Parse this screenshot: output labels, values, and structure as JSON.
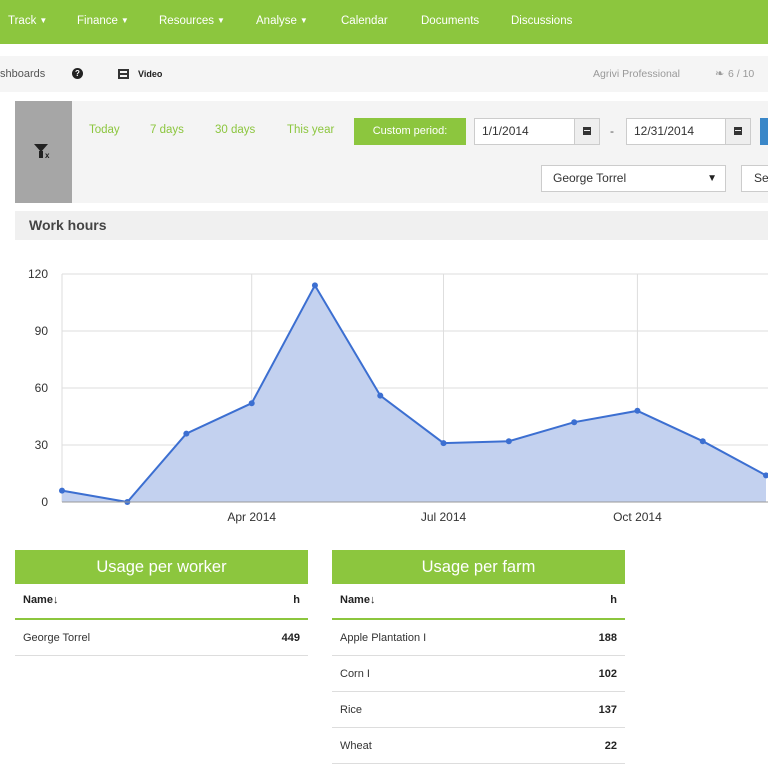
{
  "nav": {
    "items": [
      {
        "label": "Track",
        "caret": true
      },
      {
        "label": "Finance",
        "caret": true
      },
      {
        "label": "Resources",
        "caret": true
      },
      {
        "label": "Analyse",
        "caret": true
      },
      {
        "label": "Calendar",
        "caret": false
      },
      {
        "label": "Documents",
        "caret": false
      },
      {
        "label": "Discussions",
        "caret": false
      }
    ]
  },
  "subbar": {
    "dashboards_label": "shboards",
    "help_icon": "?",
    "video_label": "Video",
    "plan": "Agrivi Professional",
    "leaf_icon": "❧",
    "count": "6 / 10"
  },
  "filters": {
    "periods": [
      "Today",
      "7 days",
      "30 days",
      "This year"
    ],
    "custom_label": "Custom period:",
    "date_from": "1/1/2014",
    "date_sep": "-",
    "date_to": "12/31/2014",
    "worker_select": "George Torrel",
    "select_arrow": "▼",
    "second_button": "Se"
  },
  "section_title": "Work hours",
  "chart_data": {
    "type": "area",
    "title": "",
    "xlabel": "",
    "ylabel": "",
    "ylim": [
      0,
      120
    ],
    "yticks": [
      0,
      30,
      60,
      90,
      120
    ],
    "xticks": [
      {
        "label": "Apr 2014",
        "date": "2014-04-01"
      },
      {
        "label": "Jul 2014",
        "date": "2014-07-01"
      },
      {
        "label": "Oct 2014",
        "date": "2014-10-01"
      }
    ],
    "grid": true,
    "series": [
      {
        "color": "#3c6fd1",
        "fill": "#c3d1ef",
        "points": [
          {
            "x": "2014-01-01",
            "y": 6
          },
          {
            "x": "2014-02-01",
            "y": 0
          },
          {
            "x": "2014-03-01",
            "y": 36
          },
          {
            "x": "2014-04-01",
            "y": 52
          },
          {
            "x": "2014-05-01",
            "y": 114
          },
          {
            "x": "2014-06-01",
            "y": 56
          },
          {
            "x": "2014-07-01",
            "y": 31
          },
          {
            "x": "2014-08-01",
            "y": 32
          },
          {
            "x": "2014-09-01",
            "y": 42
          },
          {
            "x": "2014-10-01",
            "y": 48
          },
          {
            "x": "2014-11-01",
            "y": 32
          },
          {
            "x": "2014-12-01",
            "y": 14
          }
        ]
      }
    ]
  },
  "usage_worker": {
    "title": "Usage per worker",
    "col_name": "Name↓",
    "col_h": "h",
    "rows": [
      {
        "name": "George Torrel",
        "hours": "449"
      }
    ]
  },
  "usage_farm": {
    "title": "Usage per farm",
    "col_name": "Name↓",
    "col_h": "h",
    "rows": [
      {
        "name": "Apple Plantation I",
        "hours": "188"
      },
      {
        "name": "Corn I",
        "hours": "102"
      },
      {
        "name": "Rice",
        "hours": "137"
      },
      {
        "name": "Wheat",
        "hours": "22"
      }
    ]
  },
  "colors": {
    "brand_green": "#8cc63e",
    "line_blue": "#3c6fd1",
    "area_fill": "#c3d1ef",
    "button_blue": "#3a87c8"
  }
}
